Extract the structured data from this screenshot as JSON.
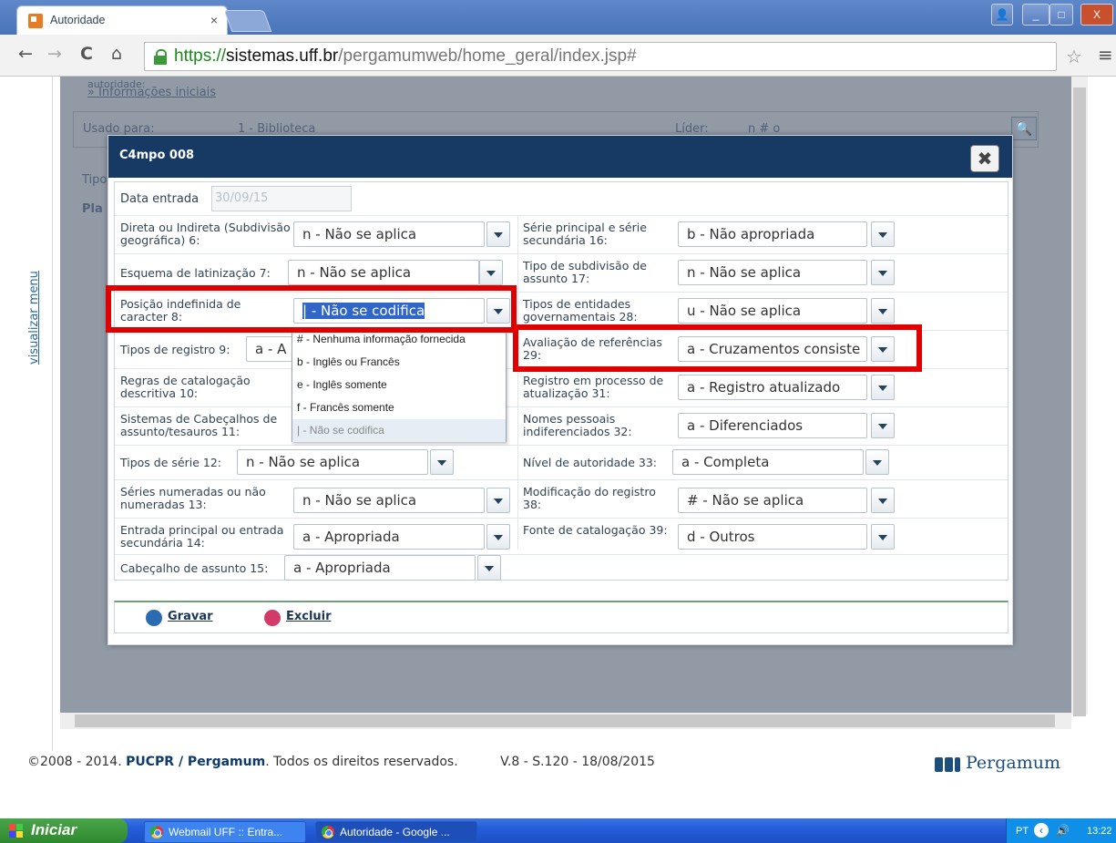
{
  "browser": {
    "tab_title": "Autoridade",
    "tab_close": "×",
    "url_scheme": "https://",
    "url_host": "sistemas.uff.br",
    "url_path": "/pergamumweb/home_geral/index.jsp#",
    "window_buttons": [
      "_",
      "□",
      "X"
    ]
  },
  "sidebar": {
    "label": "visualizar menu"
  },
  "background_page": {
    "autoridade_label": "autoridade:",
    "info_link": "» Informações iniciais",
    "usado_para_label": "Usado para:",
    "usado_para_value": "1 - Biblioteca",
    "lider_label": "Líder:",
    "lider_value": "n # o",
    "tipo_label": "Tipo",
    "pla_label": "Pla"
  },
  "modal": {
    "title": "C4mpo 008",
    "close_label": "✖",
    "data_entrada_label": "Data entrada",
    "data_entrada_value": "30/09/15",
    "fields": {
      "direta": {
        "label": "Direta ou Indireta (Subdivisão geográfica) 6:",
        "value": "n - Não se aplica"
      },
      "serie_principal": {
        "label": "Série principal e série secundária 16:",
        "value": "b - Não apropriada"
      },
      "esquema": {
        "label": "Esquema de latinização 7:",
        "value": "n - Não se aplica"
      },
      "tipo_subdivisao": {
        "label": "Tipo de subdivisão de assunto 17:",
        "value": "n - Não se aplica"
      },
      "posicao": {
        "label": "Posição indefinida de caracter 8:",
        "value": "| - Não se codifica"
      },
      "tipos_entidades": {
        "label": "Tipos de entidades governamentais 28:",
        "value": "u - Não se aplica"
      },
      "tipos_registro": {
        "label": "Tipos de registro 9:",
        "value": "a - A"
      },
      "avaliacao": {
        "label": "Avaliação de referências 29:",
        "value": "a - Cruzamentos consiste"
      },
      "regras": {
        "label": "Regras de catalogação descritiva 10:",
        "value": ""
      },
      "registro_processo": {
        "label": "Registro em processo de atualização 31:",
        "value": "a - Registro atualizado"
      },
      "sistemas": {
        "label": "Sistemas de Cabeçalhos de assunto/tesauros 11:",
        "value": ""
      },
      "nomes_pessoais": {
        "label": "Nomes pessoais indiferenciados 32:",
        "value": "a - Diferenciados"
      },
      "tipos_serie": {
        "label": "Tipos de série 12:",
        "value": "n - Não se aplica"
      },
      "nivel_autoridade": {
        "label": "Nível de autoridade 33:",
        "value": "a - Completa"
      },
      "series_numeradas": {
        "label": "Séries numeradas ou não numeradas 13:",
        "value": "n - Não se aplica"
      },
      "modificacao": {
        "label": "Modificação do registro 38:",
        "value": "# - Não se aplica"
      },
      "entrada_principal": {
        "label": "Entrada principal ou entrada secundária 14:",
        "value": "a - Apropriada"
      },
      "fonte_catalogacao": {
        "label": "Fonte de catalogação 39:",
        "value": "d - Outros"
      },
      "cabecalho_assunto": {
        "label": "Cabeçalho de assunto 15:",
        "value": "a - Apropriada"
      }
    },
    "dropdown_options": [
      "# - Nenhuma informação fornecida",
      "b - Inglês ou Francês",
      "e - Inglês somente",
      "f - Francês somente",
      "| - Não se codifica"
    ],
    "gravar_label": "Gravar",
    "excluir_label": "Excluir"
  },
  "footer": {
    "copyright_prefix": "©2008 - 2014.",
    "copyright_brand": "PUCPR / Pergamum",
    "copyright_suffix": ". Todos os direitos reservados.",
    "version": "V.8 - S.120 - 18/08/2015",
    "logo_text": "Pergamum"
  },
  "taskbar": {
    "start_label": "Iniciar",
    "task1": "Webmail UFF :: Entra...",
    "task2": "Autoridade - Google ...",
    "lang": "PT",
    "clock": "13:22"
  },
  "colors": {
    "modal_header": "#163a64",
    "highlight": "#e00000",
    "selected_text": "#2f66c8"
  }
}
